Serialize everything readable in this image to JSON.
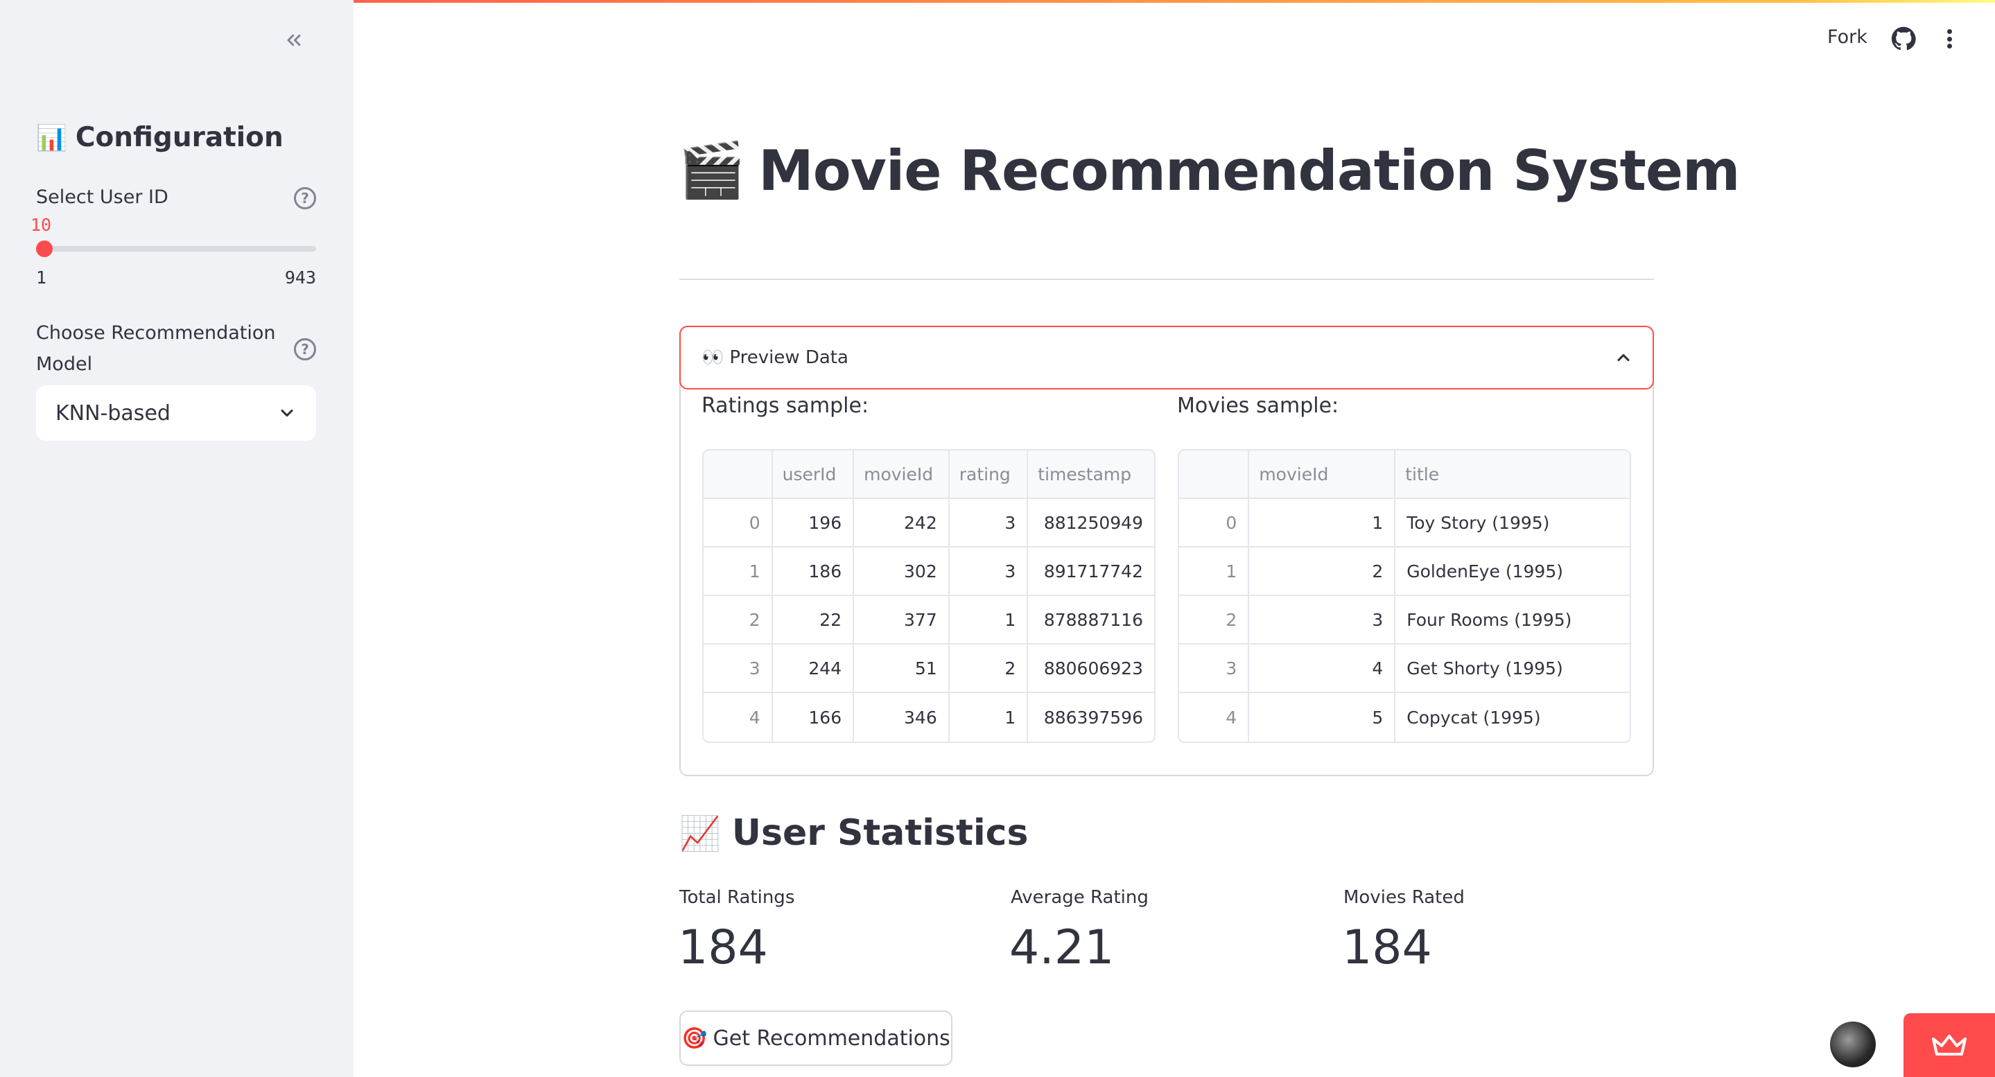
{
  "colors": {
    "accent": "#ff4b4b",
    "sidebar_bg": "#f0f2f6",
    "text": "#31333f",
    "muted": "#8a8c96"
  },
  "header": {
    "fork_label": "Fork",
    "github_icon": "github-icon",
    "menu_icon": "more-vertical-icon"
  },
  "sidebar": {
    "collapse_icon": "double-chevron-left-icon",
    "title_emoji": "📊",
    "title": "Configuration",
    "user_slider": {
      "label": "Select User ID",
      "value": "10",
      "min": "1",
      "max": "943",
      "fraction": 0.0096
    },
    "model_select": {
      "label": "Choose Recommendation Model",
      "label_line1": "Choose Recommendation",
      "label_line2": "Model",
      "value": "KNN-based"
    }
  },
  "main": {
    "title_emoji": "🎬",
    "title": "Movie Recommendation System",
    "expander": {
      "emoji": "👀",
      "label": "Preview Data",
      "ratings_label": "Ratings sample:",
      "movies_label": "Movies sample:",
      "ratings": {
        "columns": [
          "",
          "userId",
          "movieId",
          "rating",
          "timestamp"
        ],
        "rows": [
          [
            "0",
            "196",
            "242",
            "3",
            "881250949"
          ],
          [
            "1",
            "186",
            "302",
            "3",
            "891717742"
          ],
          [
            "2",
            "22",
            "377",
            "1",
            "878887116"
          ],
          [
            "3",
            "244",
            "51",
            "2",
            "880606923"
          ],
          [
            "4",
            "166",
            "346",
            "1",
            "886397596"
          ]
        ]
      },
      "movies": {
        "columns": [
          "",
          "movieId",
          "title"
        ],
        "rows": [
          [
            "0",
            "1",
            "Toy Story (1995)"
          ],
          [
            "1",
            "2",
            "GoldenEye (1995)"
          ],
          [
            "2",
            "3",
            "Four Rooms (1995)"
          ],
          [
            "3",
            "4",
            "Get Shorty (1995)"
          ],
          [
            "4",
            "5",
            "Copycat (1995)"
          ]
        ]
      }
    },
    "stats": {
      "emoji": "📈",
      "title": "User Statistics",
      "metrics": [
        {
          "label": "Total Ratings",
          "value": "184"
        },
        {
          "label": "Average Rating",
          "value": "4.21"
        },
        {
          "label": "Movies Rated",
          "value": "184"
        }
      ]
    },
    "button": {
      "emoji": "🎯",
      "label": "Get Recommendations"
    }
  }
}
